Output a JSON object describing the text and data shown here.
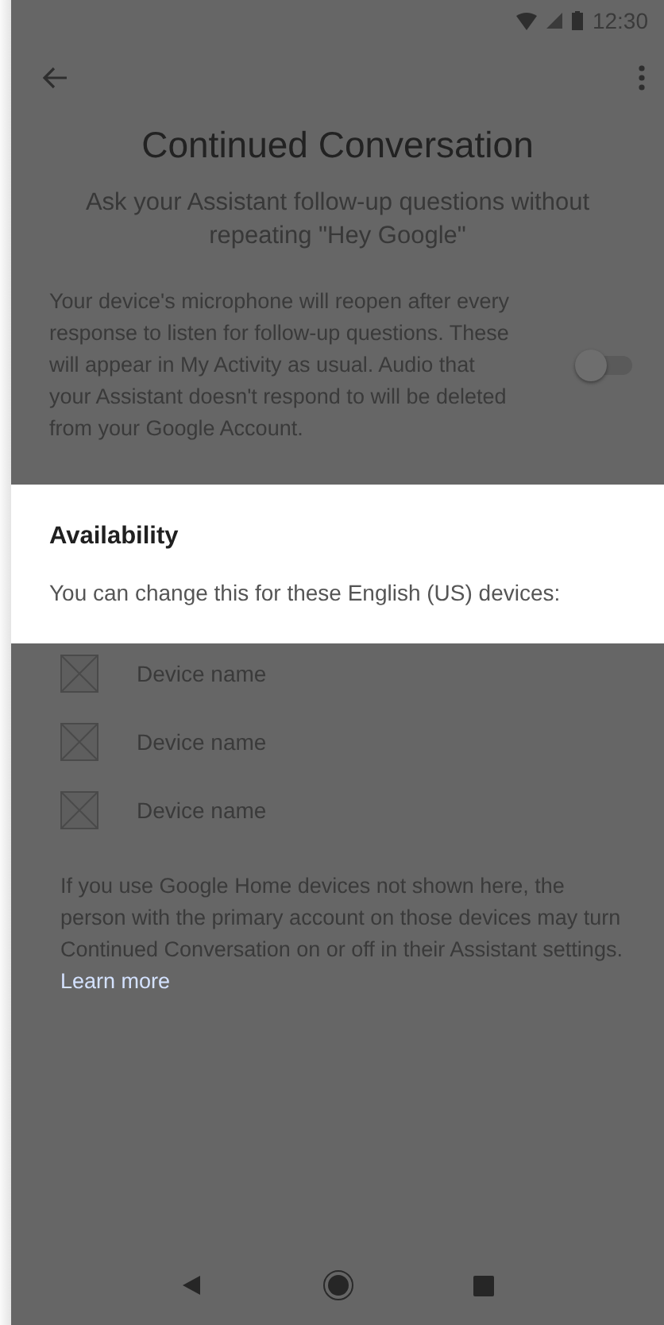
{
  "status_bar": {
    "time": "12:30"
  },
  "header": {
    "title": "Continued Conversation",
    "subtitle": "Ask your Assistant follow-up questions without repeating \"Hey Google\""
  },
  "setting": {
    "description": "Your device's microphone will reopen after every response to listen for follow-up questions. These will appear in My Activity as usual. Audio that your Assistant doesn't respond to will be deleted from your Google Account.",
    "on": false
  },
  "availability": {
    "title": "Availability",
    "text": "You can change this for these English (US) devices:"
  },
  "devices": [
    {
      "name": "Device name"
    },
    {
      "name": "Device name"
    },
    {
      "name": "Device name"
    }
  ],
  "footer": {
    "text": "If you use Google Home devices not shown here, the person with the primary account on those devices may turn Continued Conversation on or off in their Assistant settings.",
    "link": "Learn more"
  }
}
